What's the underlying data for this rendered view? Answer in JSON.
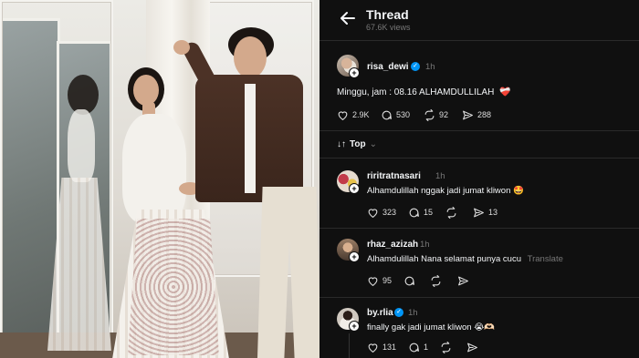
{
  "header": {
    "title": "Thread",
    "views": "67.6K views"
  },
  "main_post": {
    "username": "risa_dewi",
    "verified": true,
    "time": "1h",
    "text": "Minggu, jam : 08.16 ALHAMDULLILAH",
    "emoji": "❤️‍🩹",
    "likes": "2.9K",
    "comments": "530",
    "reposts": "92",
    "shares": "288"
  },
  "sort": {
    "label": "Top",
    "icon": "sort-arrows-icon"
  },
  "replies": [
    {
      "username": "riritratnasari",
      "verified": false,
      "time": "1h",
      "text": "Alhamdulillah nggak jadi jumat kliwon 🤩",
      "likes": "323",
      "comments": "15",
      "reposts": "",
      "shares": "13",
      "translate": ""
    },
    {
      "username": "rhaz_azizah",
      "verified": false,
      "time": "1h",
      "text": "Alhamdulillah Nana selamat punya cucu",
      "likes": "95",
      "comments": "",
      "reposts": "",
      "shares": "",
      "translate": "Translate"
    },
    {
      "username": "by.rlia",
      "verified": true,
      "time": "1h",
      "text": "finally gak jadi jumat kliwon 😭🫶🏻",
      "likes": "131",
      "comments": "1",
      "reposts": "",
      "shares": "",
      "translate": ""
    }
  ],
  "colors": {
    "background": "#101010",
    "text": "#f3f5f7",
    "muted": "#777777",
    "verified": "#0095f6",
    "divider": "#2a2a2a"
  }
}
